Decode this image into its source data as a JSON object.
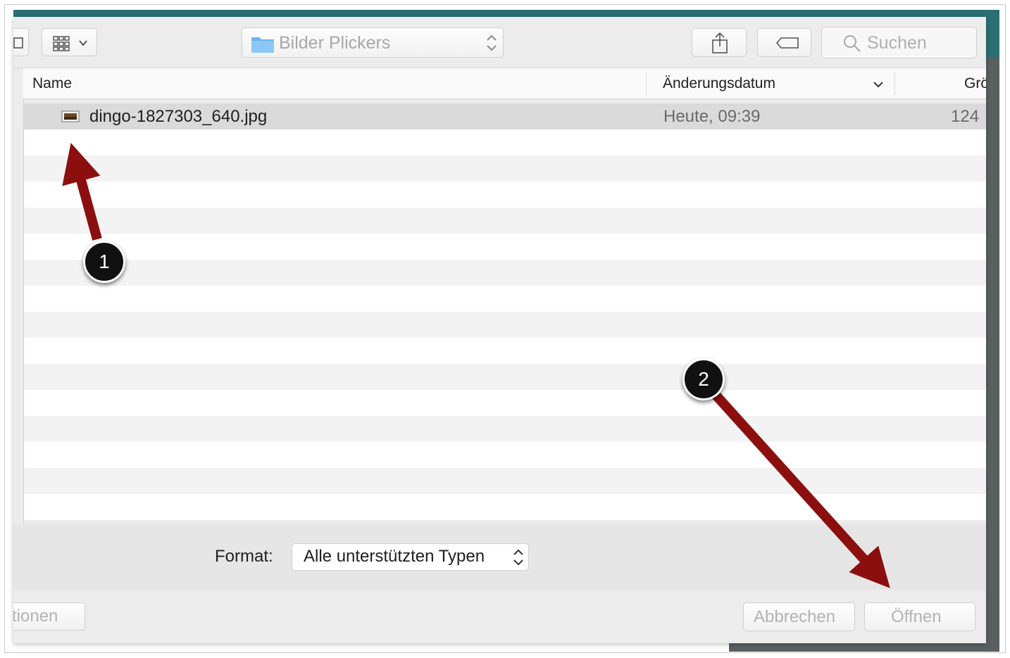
{
  "toolbar": {
    "location": "Bilder Plickers",
    "search_placeholder": "Suchen"
  },
  "columns": {
    "name": "Name",
    "modified": "Änderungsdatum",
    "size": "Grö"
  },
  "files": [
    {
      "name": "dingo-1827303_640.jpg",
      "modified": "Heute, 09:39",
      "size": "124"
    }
  ],
  "format": {
    "label": "Format:",
    "value": "Alle unterstützten Typen"
  },
  "buttons": {
    "options": "tionen",
    "cancel": "Abbrechen",
    "open": "Öffnen"
  },
  "annotations": {
    "step1": "1",
    "step2": "2",
    "arrow_color": "#8b0f0f"
  },
  "colors": {
    "window_accent": "#2b6e73"
  }
}
